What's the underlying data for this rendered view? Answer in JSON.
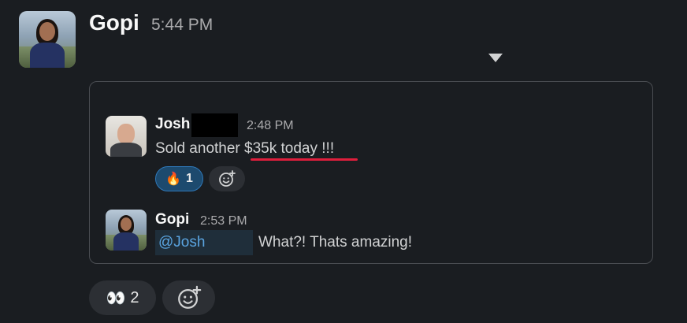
{
  "message": {
    "sender": "Gopi",
    "time": "5:44 PM"
  },
  "shared_thread": {
    "message_1": {
      "sender": "Josh",
      "time": "2:48 PM",
      "text": "Sold another $35k today !!!",
      "reactions": [
        {
          "emoji": "🔥",
          "count": "1",
          "selected": true
        }
      ]
    },
    "message_2": {
      "sender": "Gopi",
      "time": "2:53 PM",
      "mention": "@Josh",
      "text": "What?! Thats amazing!"
    }
  },
  "reactions": [
    {
      "emoji": "👀",
      "count": "2"
    }
  ],
  "colors": {
    "background": "#1a1d21",
    "underline_highlight": "#e01e3c",
    "mention_text": "#5aa4e0",
    "selected_reaction_border": "#2f78b8"
  },
  "icons": [
    "more-options-caret-icon",
    "add-reaction-icon"
  ]
}
